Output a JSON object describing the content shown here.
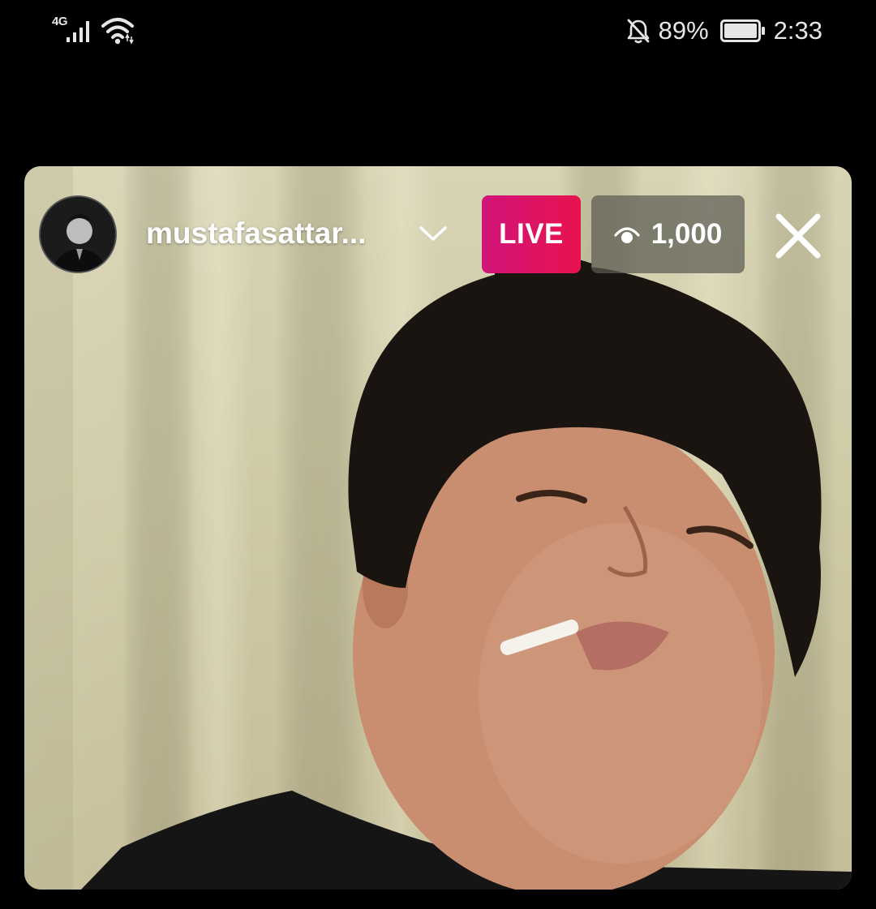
{
  "status_bar": {
    "network_type": "4G",
    "battery_percent": "89%",
    "time": "2:33",
    "icons": [
      "signal-icon",
      "wifi-icon",
      "notifications-off-icon",
      "battery-icon"
    ]
  },
  "live": {
    "username": "mustafasattar...",
    "live_label": "LIVE",
    "viewer_count": "1,000",
    "icons": [
      "avatar",
      "chevron-down-icon",
      "eye-icon",
      "close-icon"
    ],
    "colors": {
      "live_gradient_start": "#d0147a",
      "live_gradient_end": "#e8134e",
      "viewer_badge_bg": "#5a5a52"
    }
  }
}
